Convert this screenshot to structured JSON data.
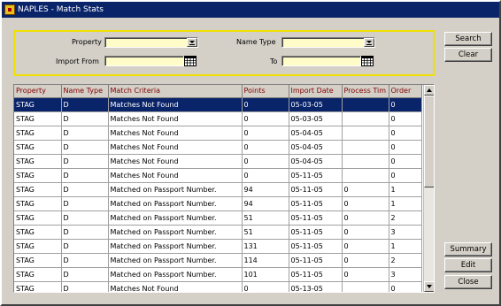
{
  "window": {
    "title": "NAPLES - Match Stats"
  },
  "search": {
    "property_label": "Property",
    "name_type_label": "Name Type",
    "import_from_label": "Import From",
    "to_label": "To",
    "property_value": "",
    "name_type_value": "",
    "import_from_value": "",
    "to_value": ""
  },
  "buttons": {
    "search": "Search",
    "clear": "Clear",
    "summary": "Summary",
    "edit": "Edit",
    "close": "Close"
  },
  "table": {
    "columns": [
      "Property",
      "Name Type",
      "Match Criteria",
      "Points",
      "Import Date",
      "Process Tim",
      "Order"
    ],
    "rows": [
      [
        "STAG",
        "D",
        "Matches Not Found",
        "0",
        "05-03-05",
        "",
        "0"
      ],
      [
        "STAG",
        "D",
        "Matches Not Found",
        "0",
        "05-03-05",
        "",
        "0"
      ],
      [
        "STAG",
        "D",
        "Matches Not Found",
        "0",
        "05-04-05",
        "",
        "0"
      ],
      [
        "STAG",
        "D",
        "Matches Not Found",
        "0",
        "05-04-05",
        "",
        "0"
      ],
      [
        "STAG",
        "D",
        "Matches Not Found",
        "0",
        "05-04-05",
        "",
        "0"
      ],
      [
        "STAG",
        "D",
        "Matches Not Found",
        "0",
        "05-11-05",
        "",
        "0"
      ],
      [
        "STAG",
        "D",
        "Matched on Passport Number.",
        "94",
        "05-11-05",
        "0",
        "1"
      ],
      [
        "STAG",
        "D",
        "Matched on Passport Number.",
        "94",
        "05-11-05",
        "0",
        "1"
      ],
      [
        "STAG",
        "D",
        "Matched on Passport Number.",
        "51",
        "05-11-05",
        "0",
        "2"
      ],
      [
        "STAG",
        "D",
        "Matched on Passport Number.",
        "51",
        "05-11-05",
        "0",
        "3"
      ],
      [
        "STAG",
        "D",
        "Matched on Passport Number.",
        "131",
        "05-11-05",
        "0",
        "1"
      ],
      [
        "STAG",
        "D",
        "Matched on Passport Number.",
        "114",
        "05-11-05",
        "0",
        "2"
      ],
      [
        "STAG",
        "D",
        "Matched on Passport Number.",
        "101",
        "05-11-05",
        "0",
        "3"
      ],
      [
        "STAG",
        "D",
        "Matches Not Found",
        "0",
        "05-13-05",
        "",
        "0"
      ]
    ]
  },
  "colors": {
    "title_bar": "#0a246a",
    "selection": "#0a246a",
    "field_background": "#fffcc8",
    "header_text": "#800000",
    "panel_border": "#f0e000"
  },
  "icons": {
    "app": "app-icon",
    "dropdown": "chevron-down-icon",
    "calendar": "calendar-icon"
  }
}
